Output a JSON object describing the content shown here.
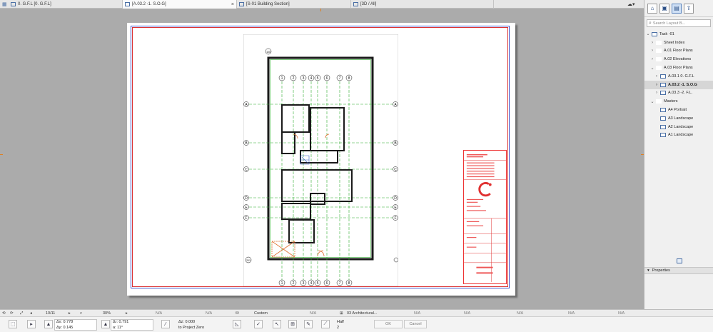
{
  "tabs": [
    {
      "label": "0. G.F.L [0. G.F.L]"
    },
    {
      "label": "[A.03.2 -1. S.O.G]",
      "active": true
    },
    {
      "label": "[S-01 Building Section]"
    },
    {
      "label": "[3D / All]"
    }
  ],
  "panel": {
    "search_placeholder": "Search Layout B...",
    "tree": [
      {
        "label": "Task -01"
      },
      {
        "label": "Sheet Index"
      },
      {
        "label": "A.01 Floor Plans"
      },
      {
        "label": "A.02 Elevations"
      },
      {
        "label": "A.03 Floor Plans"
      },
      {
        "label": "A.03.1 0. G.F.L"
      },
      {
        "label": "A.03.2 -1. S.O.G",
        "selected": true
      },
      {
        "label": "A.03.3 -2. F.L."
      },
      {
        "label": "Masters"
      },
      {
        "label": "A4 Portrait"
      },
      {
        "label": "A3 Landscape"
      },
      {
        "label": "A2 Landscape"
      },
      {
        "label": "A1 Landscape"
      }
    ],
    "properties_label": "Properties"
  },
  "plan": {
    "grid_top": [
      "1",
      "2",
      "3",
      "4",
      "5",
      "6",
      "7",
      "8"
    ],
    "grid_side": [
      "A",
      "B",
      "C",
      "D",
      "E",
      "F"
    ],
    "corner": "100",
    "corner_bottom": "201"
  },
  "status": {
    "page": "10/11",
    "zoom": "30%",
    "na": "N/A",
    "custom": "Custom",
    "layer": "03 Architectural..."
  },
  "info": {
    "ax": "Δx: 0.778",
    "ay": "Δy: 0.145",
    "ar": "Δr: 0.791",
    "aa": "a: 11°",
    "az": "Δz: 0.000",
    "zero": "to Project Zero",
    "half": "Half",
    "half_sub": "2",
    "ok": "OK",
    "cancel": "Cancel"
  },
  "colors": {
    "accent": "#3d6fb8",
    "titleblock": "#e03030",
    "wall": "#1a1a1a",
    "grid": "#2eae2e"
  }
}
